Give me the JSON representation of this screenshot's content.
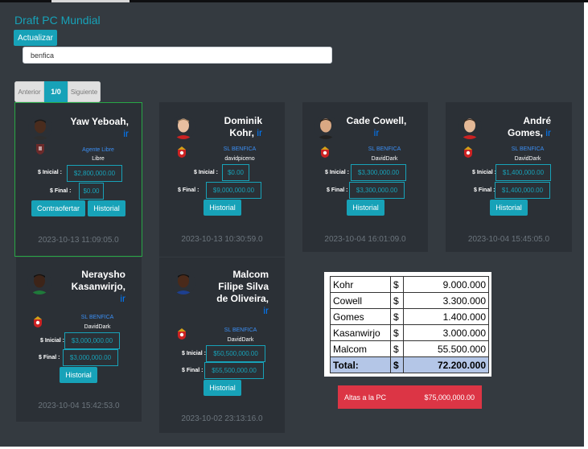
{
  "page": {
    "title": "Draft PC Mundial",
    "update_label": "Actualizar",
    "search_value": "benfica"
  },
  "pager": {
    "prev": "Anterior",
    "current": "1/0",
    "next": "Siguiente"
  },
  "labels": {
    "ir": "ir",
    "initial": "$ Inicial :",
    "final": "$ Final :",
    "counteroffer": "Contraofertar",
    "history": "Historial"
  },
  "cards": [
    {
      "name_line1": "Yaw Yeboah,",
      "name_line2": "",
      "club": "Agente Libre",
      "owner": "Libre",
      "initial": "$2,800,000.00",
      "final": "$0.00",
      "date": "2023-10-13 11:09:05.0",
      "jersey": "#2e2e2e",
      "crest": "dark"
    },
    {
      "name_line1": "Dominik",
      "name_line2": "Kohr,",
      "club": "SL BENFICA",
      "owner": "davidpiceno",
      "initial": "$0.00",
      "final": "$9,000,000.00",
      "date": "2023-10-13 10:30:59.0",
      "jersey": "#cc2222",
      "crest": "benfica"
    },
    {
      "name_line1": "Cade Cowell,",
      "name_line2": "",
      "club": "SL BENFICA",
      "owner": "DavidDark",
      "initial": "$3,300,000.00",
      "final": "$3,300,000.00",
      "date": "2023-10-04 16:01:09.0",
      "jersey": "#222222",
      "crest": "benfica"
    },
    {
      "name_line1": "André",
      "name_line2": "Gomes,",
      "club": "SL BENFICA",
      "owner": "DavidDark",
      "initial": "$1,400,000.00",
      "final": "$1,400,000.00",
      "date": "2023-10-04 15:45:05.0",
      "jersey": "#cc2222",
      "crest": "benfica"
    },
    {
      "name_line1": "Neraysho",
      "name_line2": "Kasanwirjo,",
      "name_line3": "",
      "club": "SL BENFICA",
      "owner": "DavidDark",
      "initial": "$3,000,000.00",
      "final": "$3,000,000.00",
      "date": "2023-10-04 15:42:53.0",
      "jersey": "#1f7a3a",
      "crest": "benfica"
    },
    {
      "name_line1": "Malcom",
      "name_line2": "Filipe Silva",
      "name_line3": "de Oliveira,",
      "club": "SL BENFICA",
      "owner": "DavidDark",
      "initial": "$50,500,000.00",
      "final": "$55,500,000.00",
      "date": "2023-10-02 23:13:16.0",
      "jersey": "#1d3f8f",
      "crest": "benfica"
    }
  ],
  "summary": {
    "rows": [
      {
        "name": "Kohr",
        "cur": "$",
        "value": "9.000.000"
      },
      {
        "name": "Cowell",
        "cur": "$",
        "value": "3.300.000"
      },
      {
        "name": "Gomes",
        "cur": "$",
        "value": "1.400.000"
      },
      {
        "name": "Kasanwirjo",
        "cur": "$",
        "value": "3.000.000"
      },
      {
        "name": "Malcom",
        "cur": "$",
        "value": "55.500.000"
      }
    ],
    "total_label": "Total:",
    "total_cur": "$",
    "total_value": "72.200.000"
  },
  "altas": {
    "label": "Altas a la PC",
    "value": "$75,000,000.00"
  },
  "colors": {
    "accent": "#17a2b8",
    "panel": "#343a40",
    "card": "#2b3036",
    "danger": "#dc3545",
    "link": "#007bff",
    "selected_border": "#28a745",
    "total_row": "#b4c6e7"
  }
}
